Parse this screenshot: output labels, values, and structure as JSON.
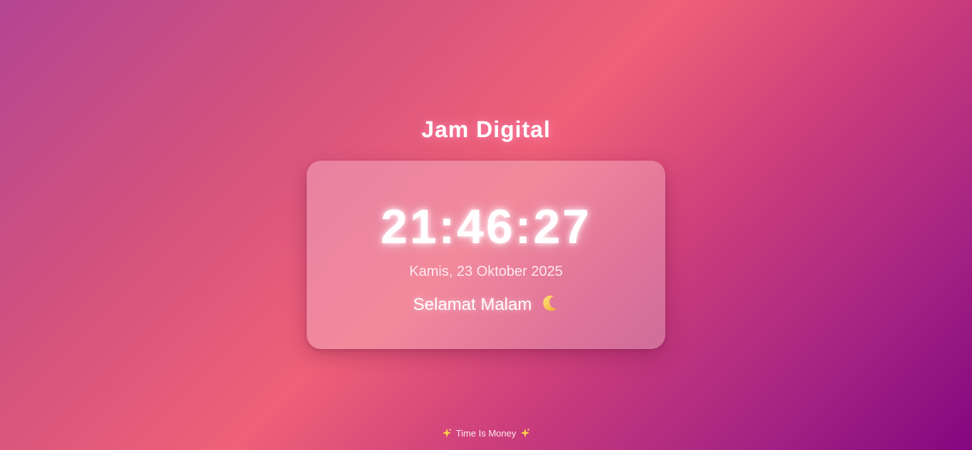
{
  "header": {
    "title": "Jam Digital"
  },
  "clock": {
    "time": "21:46:27",
    "date": "Kamis, 23 Oktober 2025",
    "greeting": "Selamat Malam",
    "greeting_icon": "crescent-moon-icon"
  },
  "footer": {
    "text": "Time Is Money",
    "icon": "sparkles-icon"
  },
  "colors": {
    "gradient_start": "#b44592",
    "gradient_mid": "#f06078",
    "gradient_end": "#840680",
    "card": "#f28c9e",
    "text": "#ffffff"
  }
}
